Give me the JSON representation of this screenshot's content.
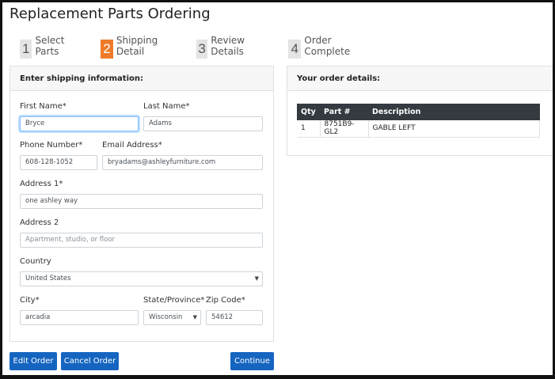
{
  "page_title": "Replacement Parts Ordering",
  "steps": [
    {
      "number": "1",
      "label": "Select Parts",
      "active": false
    },
    {
      "number": "2",
      "label": "Shipping Detail",
      "active": true
    },
    {
      "number": "3",
      "label": "Review Details",
      "active": false
    },
    {
      "number": "4",
      "label": "Order Complete",
      "active": false
    }
  ],
  "shipping": {
    "header": "Enter shipping information:",
    "first_name": {
      "label": "First Name*",
      "value": "Bryce"
    },
    "last_name": {
      "label": "Last Name*",
      "value": "Adams"
    },
    "phone": {
      "label": "Phone Number*",
      "value": "608-128-1052"
    },
    "email": {
      "label": "Email Address*",
      "value": "bryadams@ashleyfurniture.com"
    },
    "address1": {
      "label": "Address 1*",
      "value": "one ashley way"
    },
    "address2": {
      "label": "Address 2",
      "placeholder": "Apartment, studio, or floor"
    },
    "country": {
      "label": "Country",
      "value": "United States"
    },
    "city": {
      "label": "City*",
      "value": "arcadia"
    },
    "state": {
      "label": "State/Province*",
      "value": "Wisconsin"
    },
    "zip": {
      "label": "Zip Code*",
      "value": "54612"
    }
  },
  "order": {
    "header": "Your order details:",
    "columns": [
      "Qty",
      "Part #",
      "Description"
    ],
    "rows": [
      {
        "qty": "1",
        "part": "8751B9-GL2",
        "description": "GABLE LEFT"
      }
    ]
  },
  "buttons": {
    "edit_order": "Edit Order",
    "cancel_order": "Cancel Order",
    "continue": "Continue"
  },
  "colors": {
    "accent_step": "#ef7b2a",
    "primary_button": "#1565c0",
    "table_header": "#343a40"
  }
}
